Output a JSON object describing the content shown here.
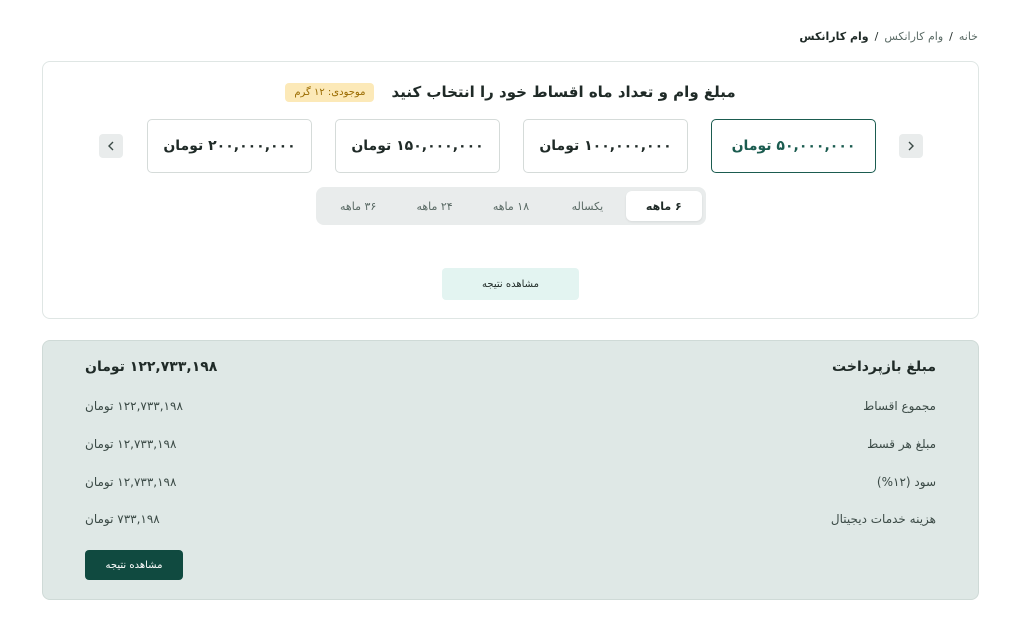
{
  "breadcrumb": {
    "home": "خانه",
    "parent": "وام کارانکس",
    "current": "وام کارانکس",
    "separator": "/"
  },
  "selector": {
    "title": "مبلغ وام و تعداد ماه اقساط خود را انتخاب کنید",
    "stock_badge": "موجودی: ۱۲ گرم",
    "amounts": [
      "۵۰,۰۰۰,۰۰۰ تومان",
      "۱۰۰,۰۰۰,۰۰۰ تومان",
      "۱۵۰,۰۰۰,۰۰۰ تومان",
      "۲۰۰,۰۰۰,۰۰۰ تومان"
    ],
    "selected_amount_index": 0,
    "prev_icon": "chevron-right-icon",
    "next_icon": "chevron-left-icon",
    "months": [
      "۶ ماهه",
      "یکساله",
      "۱۸ ماهه",
      "۲۴ ماهه",
      "۳۶ ماهه"
    ],
    "selected_month_index": 0,
    "view_result_label": "مشاهده نتیجه"
  },
  "summary": {
    "title": "مبلغ بازپرداخت",
    "total": "۱۲۲,۷۳۳,۱۹۸ تومان",
    "rows": [
      {
        "label": "مجموع اقساط",
        "value": "۱۲۲,۷۳۳,۱۹۸ تومان"
      },
      {
        "label": "مبلغ هر قسط",
        "value": "۱۲,۷۳۳,۱۹۸ تومان"
      },
      {
        "label": "سود (۱۲%)",
        "value": "۱۲,۷۳۳,۱۹۸ تومان"
      },
      {
        "label": "هزینه خدمات دیجیتال",
        "value": "۷۳۳,۱۹۸ تومان"
      }
    ],
    "view_result_label": "مشاهده نتیجه"
  },
  "colors": {
    "primary": "#104a40",
    "accent_light": "#e3f4f1",
    "badge_bg": "#fce9b8",
    "summary_bg": "#dfe8e6"
  }
}
